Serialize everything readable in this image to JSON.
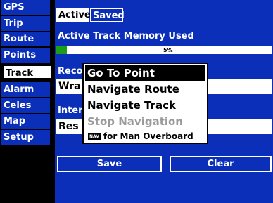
{
  "sidebar": {
    "items": [
      {
        "label": "GPS"
      },
      {
        "label": "Trip"
      },
      {
        "label": "Route"
      },
      {
        "label": "Points"
      },
      {
        "label": "Track"
      },
      {
        "label": "Alarm"
      },
      {
        "label": "Celes"
      },
      {
        "label": "Map"
      },
      {
        "label": "Setup"
      }
    ],
    "selected": "Track"
  },
  "tabs": {
    "active": "Active",
    "inactive": "Saved"
  },
  "memory": {
    "title": "Active Track Memory Used",
    "percent_label": "5%",
    "fraction": 0.05
  },
  "record": {
    "label": "Reco",
    "value": "Wra"
  },
  "interval": {
    "label": "Inter",
    "value": "Res"
  },
  "buttons": {
    "save": "Save",
    "clear": "Clear"
  },
  "menu": {
    "items": [
      {
        "label": "Go To Point",
        "state": "selected"
      },
      {
        "label": "Navigate Route",
        "state": "normal"
      },
      {
        "label": "Navigate Track",
        "state": "normal"
      },
      {
        "label": "Stop Navigation",
        "state": "disabled"
      }
    ],
    "hint_key": "NAV",
    "hint_text": "for Man Overboard"
  },
  "colors": {
    "panel_blue": "#0b2fb8",
    "progress_green": "#1a9d1a"
  }
}
